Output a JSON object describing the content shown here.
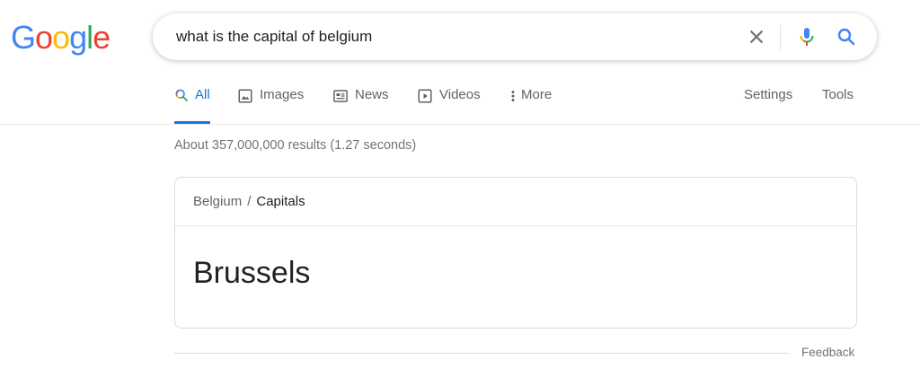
{
  "logo": {
    "letters": [
      {
        "char": "G",
        "color": "#4285F4"
      },
      {
        "char": "o",
        "color": "#EA4335"
      },
      {
        "char": "o",
        "color": "#FBBC05"
      },
      {
        "char": "g",
        "color": "#4285F4"
      },
      {
        "char": "l",
        "color": "#34A853"
      },
      {
        "char": "e",
        "color": "#EA4335"
      }
    ]
  },
  "search": {
    "query": "what is the capital of belgium",
    "icons": {
      "clear": "close-icon",
      "voice": "microphone-icon",
      "submit": "search-icon"
    }
  },
  "tabs": {
    "all": {
      "label": "All",
      "icon": "search-icon",
      "active": true
    },
    "images": {
      "label": "Images",
      "icon": "image-icon"
    },
    "news": {
      "label": "News",
      "icon": "newspaper-icon"
    },
    "videos": {
      "label": "Videos",
      "icon": "play-icon"
    },
    "more": {
      "label": "More",
      "icon": "vertical-dots-icon"
    },
    "settings": {
      "label": "Settings"
    },
    "tools": {
      "label": "Tools"
    }
  },
  "results": {
    "stats": "About 357,000,000 results (1.27 seconds)"
  },
  "answer_card": {
    "breadcrumb_parent": "Belgium",
    "breadcrumb_separator": "/",
    "breadcrumb_current": "Capitals",
    "answer": "Brussels"
  },
  "footer": {
    "feedback": "Feedback"
  },
  "colors": {
    "accent": "#1a73e8",
    "text_primary": "#202124",
    "text_secondary": "#5f6368"
  }
}
